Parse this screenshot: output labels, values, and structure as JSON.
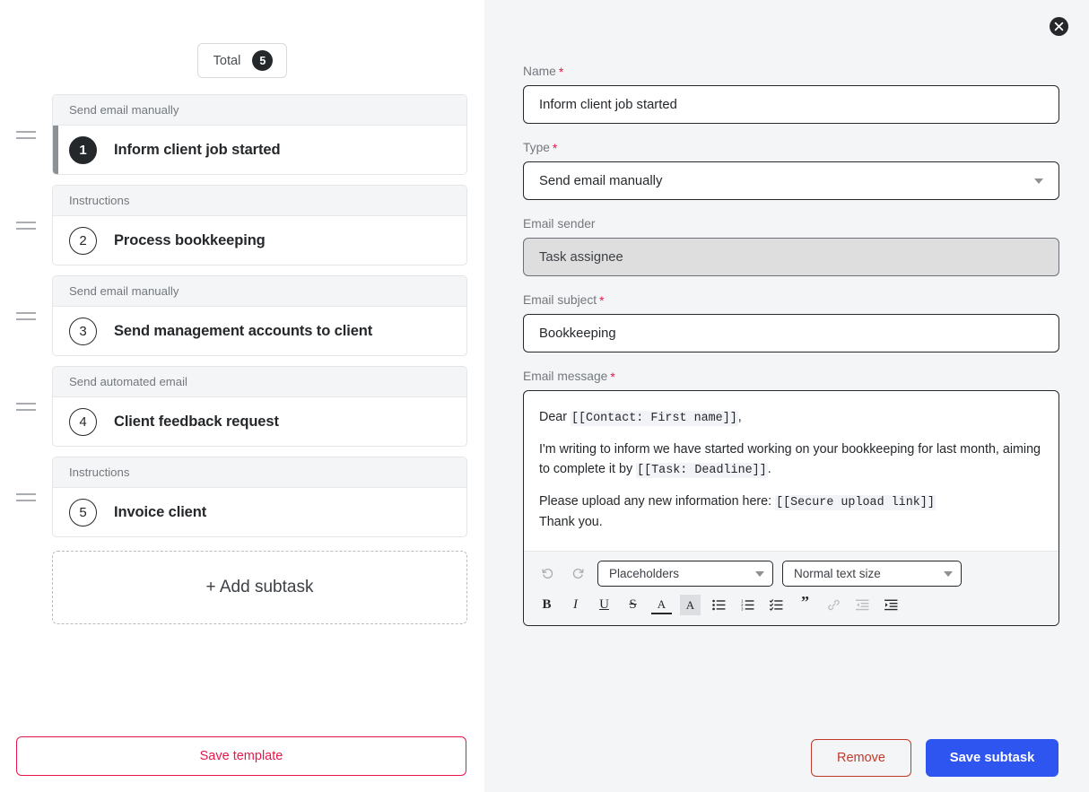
{
  "left": {
    "total": {
      "label": "Total",
      "count": "5"
    },
    "subtasks": [
      {
        "type": "Send email manually",
        "number": "1",
        "title": "Inform client job started",
        "selected": true
      },
      {
        "type": "Instructions",
        "number": "2",
        "title": "Process bookkeeping",
        "selected": false
      },
      {
        "type": "Send email manually",
        "number": "3",
        "title": "Send management accounts to client",
        "selected": false
      },
      {
        "type": "Send automated email",
        "number": "4",
        "title": "Client feedback request",
        "selected": false
      },
      {
        "type": "Instructions",
        "number": "5",
        "title": "Invoice client",
        "selected": false
      }
    ],
    "add_subtask_label": "+ Add subtask",
    "save_template_label": "Save template"
  },
  "right": {
    "close_icon": "close-icon",
    "fields": {
      "name": {
        "label": "Name",
        "required": "*",
        "value": "Inform client job started"
      },
      "type": {
        "label": "Type",
        "required": "*",
        "value": "Send email manually"
      },
      "email_sender": {
        "label": "Email sender",
        "value": "Task assignee",
        "disabled": true
      },
      "email_subject": {
        "label": "Email subject",
        "required": "*",
        "value": "Bookkeeping"
      },
      "email_message": {
        "label": "Email message",
        "required": "*"
      }
    },
    "message": {
      "line1_pre": "Dear ",
      "line1_ph": "[[Contact: First name]]",
      "line1_post": ",",
      "line2_pre": "I'm writing to inform we have started working on your bookkeeping for last month, aiming to complete it by ",
      "line2_ph": "[[Task: Deadline]]",
      "line2_post": ".",
      "line3_pre": "Please upload any new information here: ",
      "line3_ph": "[[Secure upload link]]",
      "line4": "Thank you."
    },
    "toolbar": {
      "undo_icon": "undo-icon",
      "redo_icon": "redo-icon",
      "placeholders_label": "Placeholders",
      "text_size_label": "Normal text size",
      "bold": "B",
      "italic": "I",
      "underline": "U",
      "strikethrough": "S",
      "text_color": "A",
      "highlight": "A",
      "bullet_list_icon": "bullet-list-icon",
      "numbered_list_icon": "numbered-list-icon",
      "check_list_icon": "check-list-icon",
      "quote": "”",
      "link_icon": "link-icon",
      "outdent_icon": "outdent-icon",
      "indent_icon": "indent-icon"
    },
    "actions": {
      "remove_label": "Remove",
      "save_label": "Save subtask"
    }
  },
  "colors": {
    "accent_pink": "#e8174a",
    "accent_blue": "#2f55f0",
    "remove_red": "#c0392b",
    "dark": "#25282b",
    "panel_bg": "#f4f5f6"
  }
}
